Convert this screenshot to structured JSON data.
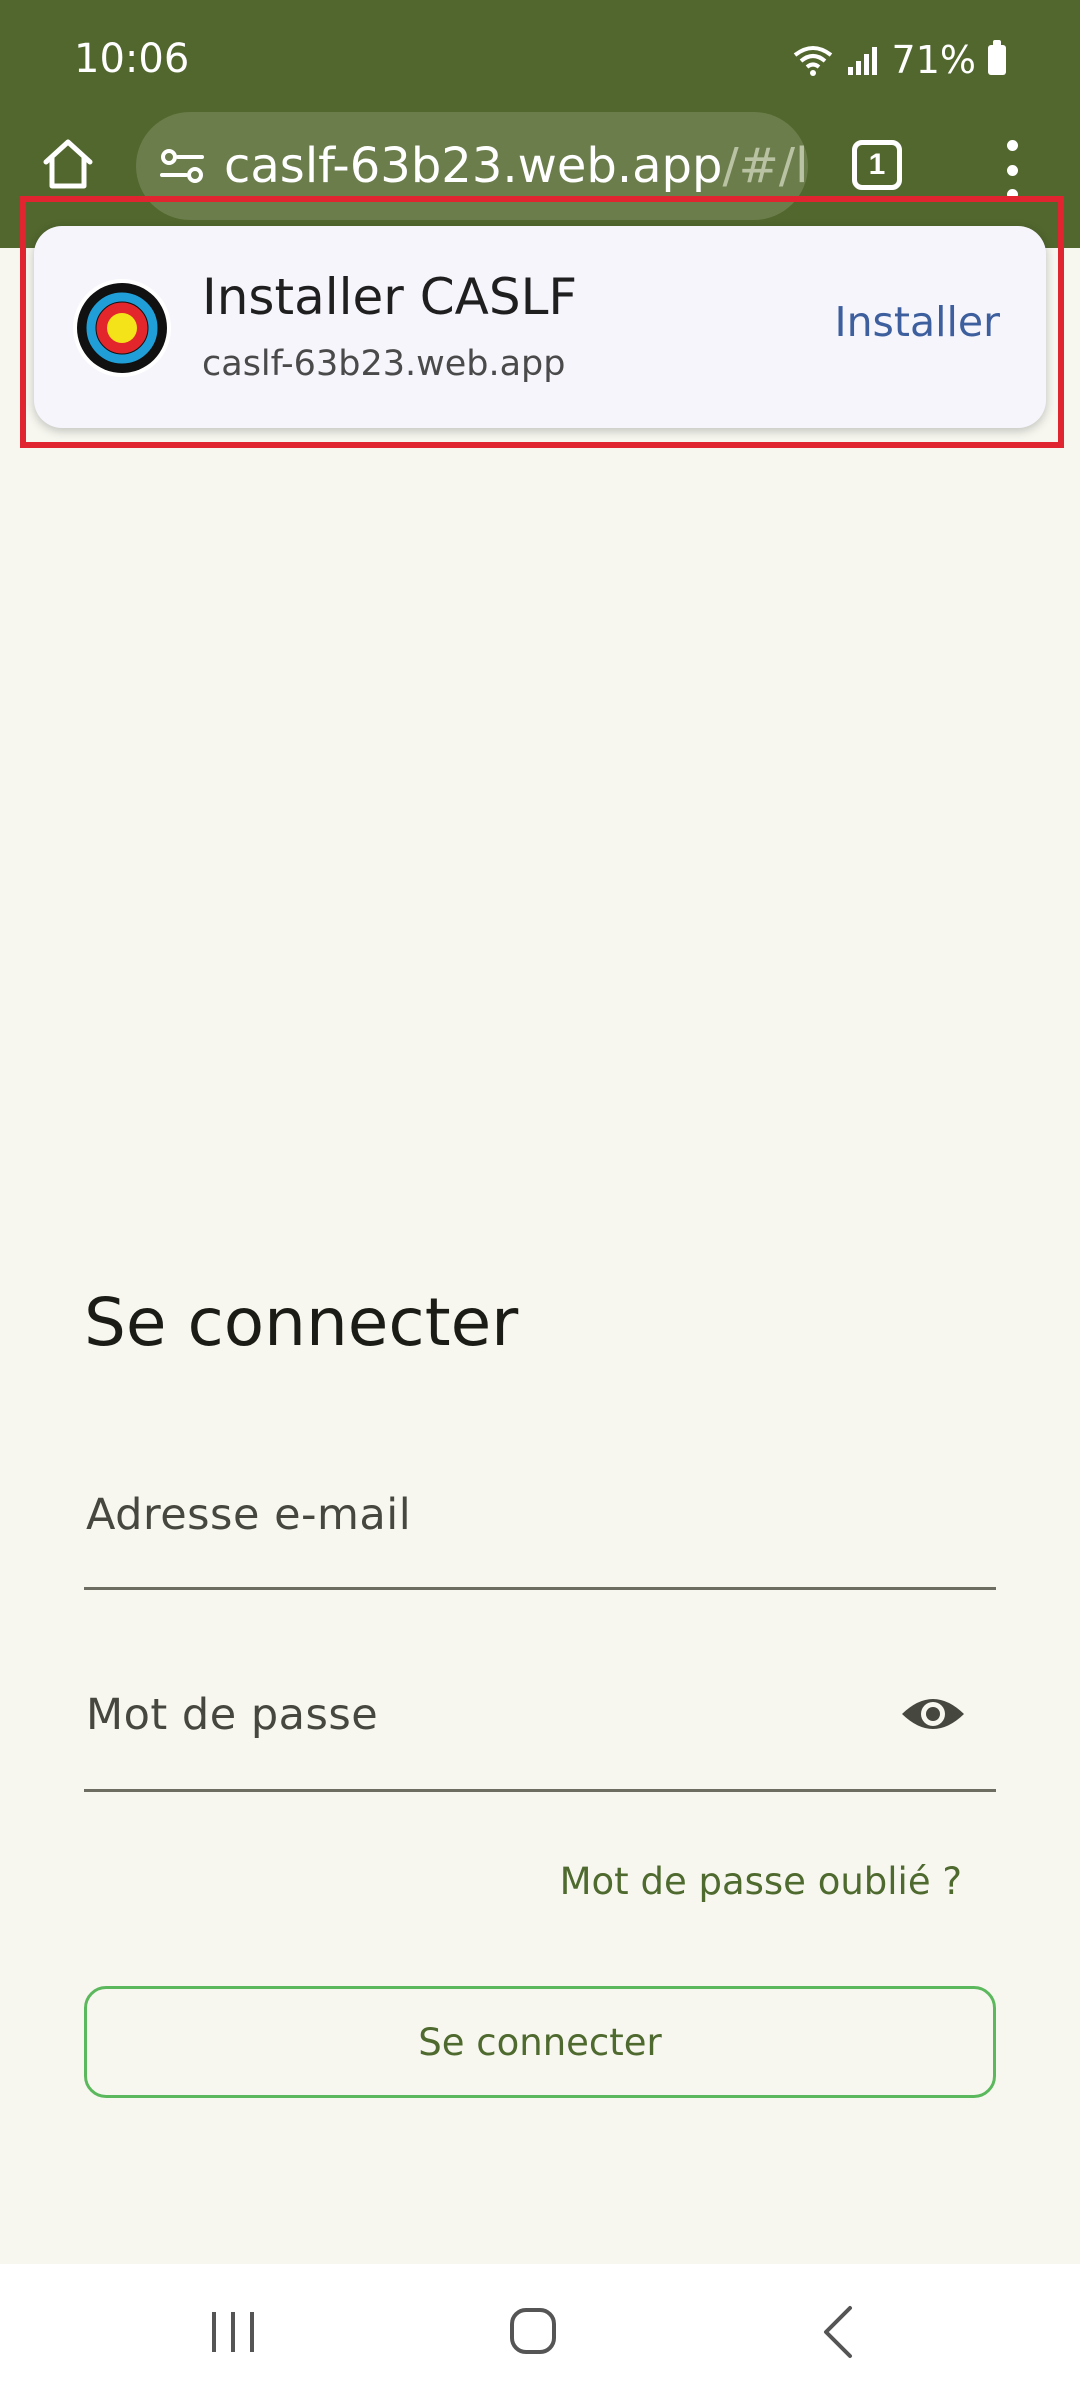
{
  "status_bar": {
    "time": "10:06",
    "battery": "71%"
  },
  "browser": {
    "url_main": "caslf-63b23.web.app",
    "url_rest": "/#/l",
    "tab_count": "1"
  },
  "install_banner": {
    "title": "Installer CASLF",
    "subtitle": "caslf-63b23.web.app",
    "button_label": "Installer"
  },
  "login": {
    "title": "Se connecter",
    "email_label": "Adresse e-mail",
    "password_label": "Mot de passe",
    "forgot_link": "Mot de passe oublié ?",
    "submit_label": "Se connecter"
  },
  "colors": {
    "toolbar": "#51672e",
    "page_background": "#f7f7f0",
    "accent_text": "#4f6a2f",
    "button_border": "#5cb85c",
    "install_action": "#3e5f9e",
    "highlight": "#e02430"
  }
}
